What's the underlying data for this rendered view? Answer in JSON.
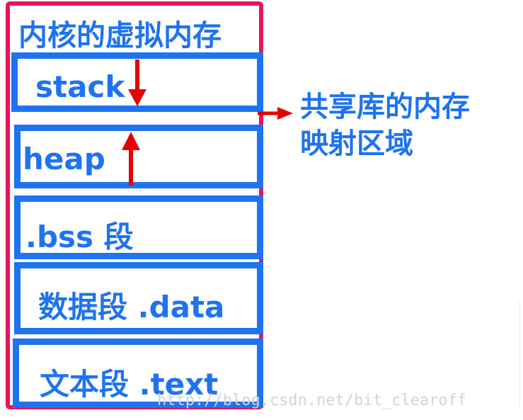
{
  "title": "内核的虚拟内存",
  "regions": {
    "stack": "stack",
    "heap": "heap",
    "bss": ".bss 段",
    "data": "数据段 .data",
    "text": "文本段 .text"
  },
  "shared_region": {
    "line1": "共享库的内存",
    "line2": "映射区域"
  },
  "watermark": "http://blog.csdn.net/bit_clearoff",
  "colors": {
    "outer_border": "#e8145e",
    "box_border": "#1e73f0",
    "label": "#1e73f0",
    "arrow": "#e60000"
  }
}
